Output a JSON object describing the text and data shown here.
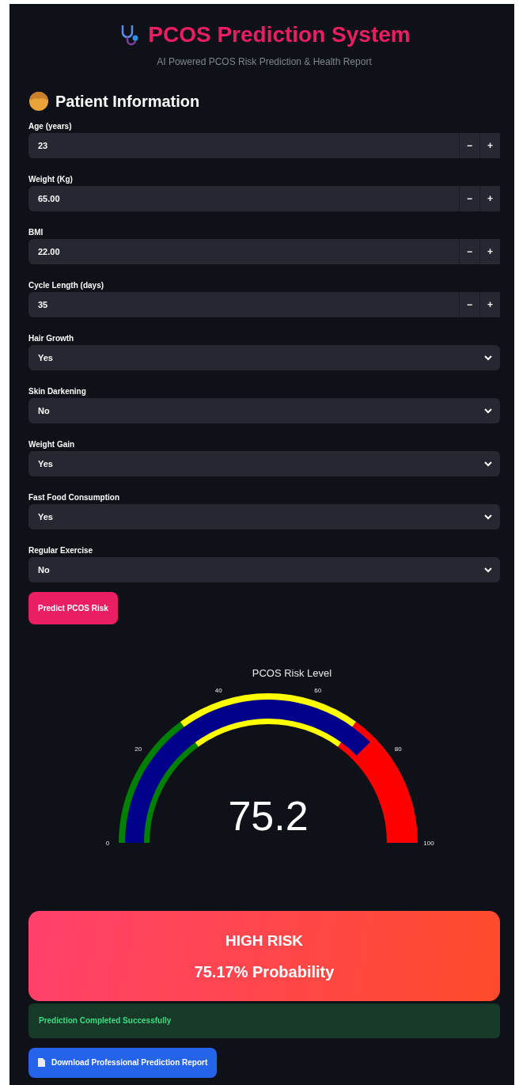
{
  "header": {
    "title": "PCOS Prediction System",
    "subtitle": "AI Powered PCOS Risk Prediction & Health Report"
  },
  "section": {
    "title": "Patient Information"
  },
  "fields": [
    {
      "kind": "number",
      "label": "Age (years)",
      "value": "23",
      "minus": "−",
      "plus": "+"
    },
    {
      "kind": "number",
      "label": "Weight (Kg)",
      "value": "65.00",
      "minus": "−",
      "plus": "+"
    },
    {
      "kind": "number",
      "label": "BMI",
      "value": "22.00",
      "minus": "−",
      "plus": "+"
    },
    {
      "kind": "number",
      "label": "Cycle Length (days)",
      "value": "35",
      "minus": "−",
      "plus": "+"
    },
    {
      "kind": "select",
      "label": "Hair Growth",
      "value": "Yes"
    },
    {
      "kind": "select",
      "label": "Skin Darkening",
      "value": "No"
    },
    {
      "kind": "select",
      "label": "Weight Gain",
      "value": "Yes"
    },
    {
      "kind": "select",
      "label": "Fast Food Consumption",
      "value": "Yes"
    },
    {
      "kind": "select",
      "label": "Regular Exercise",
      "value": "No"
    }
  ],
  "predict_button": {
    "label": "Predict PCOS Risk"
  },
  "gauge": {
    "title": "PCOS Risk Level",
    "value_text": "75.2",
    "ticks": [
      "0",
      "20",
      "40",
      "60",
      "80",
      "100"
    ],
    "steps": [
      {
        "color": "#008000"
      },
      {
        "color": "#ffff00"
      },
      {
        "color": "#ff0000"
      }
    ]
  },
  "result": {
    "risk": "HIGH RISK",
    "probability": "75.17% Probability"
  },
  "alert": {
    "kind": "success",
    "text": "Prediction Completed Successfully"
  },
  "download_button": {
    "label": "Download Professional Prediction Report"
  }
}
